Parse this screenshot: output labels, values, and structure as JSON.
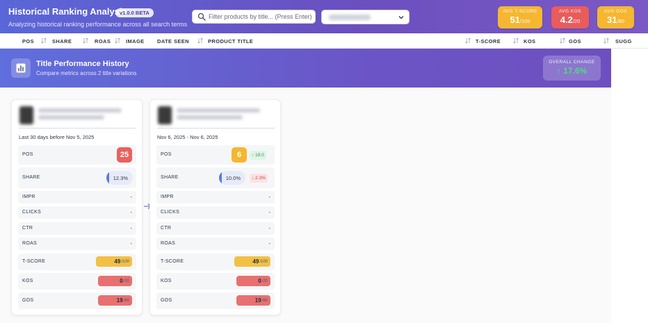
{
  "header": {
    "title": "Historical Ranking Analysis",
    "version": "v1.0.0 BETA",
    "subtitle": "Analyzing historical ranking performance across all search terms",
    "search_placeholder": "Filter products by title... (Press Enter)",
    "select_value": "",
    "metrics": [
      {
        "label": "AVG T-SCORE",
        "value": "51",
        "max": "/100",
        "color": "#f5b731"
      },
      {
        "label": "AVG KOS",
        "value": "4.2",
        "max": "/20",
        "color": "#e85c5c"
      },
      {
        "label": "AVG GOS",
        "value": "31",
        "max": "/80",
        "color": "#f5b731"
      }
    ]
  },
  "columns": [
    "POS",
    "SHARE",
    "ROAS",
    "IMAGE",
    "DATE SEEN",
    "PRODUCT TITLE",
    "T-SCORE",
    "KOS",
    "GOS",
    "SUGG"
  ],
  "banner": {
    "title": "Title Performance History",
    "subtitle": "Compare metrics across 2 title variations",
    "overall_change_label": "OVERALL CHANGE",
    "overall_change_value": "↑ 17.6%"
  },
  "cards": [
    {
      "date_range": "Last 30 days before Nov 5, 2025",
      "pos": "25",
      "share": "12.3%",
      "share_fraction": 0.123,
      "impr": "-",
      "clicks": "-",
      "ctr": "-",
      "roas": "-",
      "tscore": "49",
      "tscore_max": "/100",
      "kos": "0",
      "kos_max": "/20",
      "gos": "19",
      "gos_max": "/80"
    },
    {
      "date_range": "Nov 6, 2025 - Nov 6, 2025",
      "pos": "6",
      "pos_delta": "↑ 19.0",
      "share": "10.0%",
      "share_fraction": 0.1,
      "share_delta": "↓ 2.3%",
      "impr": "-",
      "clicks": "-",
      "ctr": "-",
      "roas": "-",
      "tscore": "49",
      "tscore_max": "/100",
      "kos": "0",
      "kos_max": "/20",
      "gos": "19",
      "gos_max": "/80"
    }
  ],
  "metric_labels": {
    "pos": "POS",
    "share": "SHARE",
    "impr": "IMPR",
    "clicks": "CLICKS",
    "ctr": "CTR",
    "roas": "ROAS",
    "tscore": "T-SCORE",
    "kos": "KOS",
    "gos": "GOS"
  },
  "icons": {
    "search": "search-icon",
    "chevron": "chevron-down-icon",
    "sort": "sort-icon",
    "chart": "bar-chart-icon",
    "arrow": "arrow-right-icon"
  }
}
